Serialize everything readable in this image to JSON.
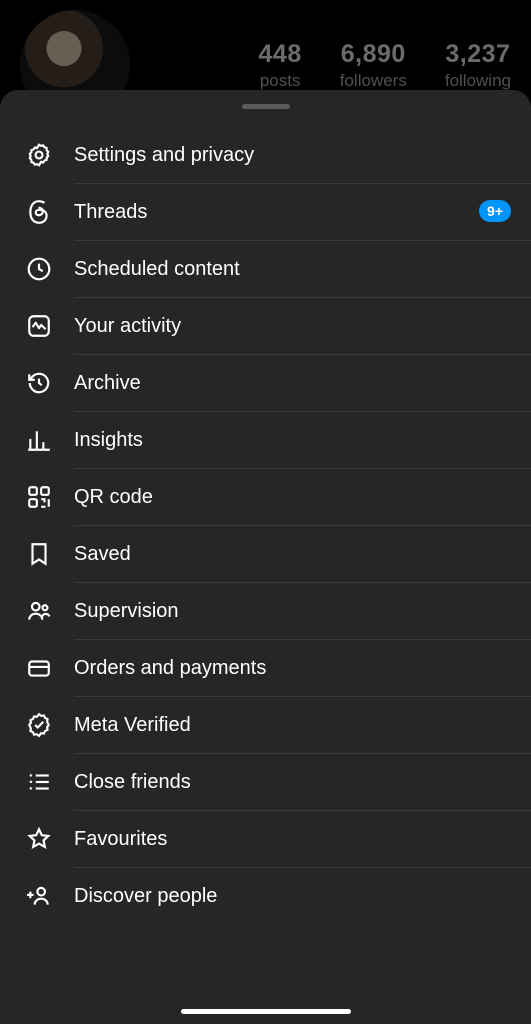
{
  "profile": {
    "stats": {
      "posts": {
        "count": "448",
        "label": "posts"
      },
      "followers": {
        "count": "6,890",
        "label": "followers"
      },
      "following": {
        "count": "3,237",
        "label": "following"
      }
    }
  },
  "menu": {
    "items": [
      {
        "id": "settings",
        "label": "Settings and privacy",
        "badge": null
      },
      {
        "id": "threads",
        "label": "Threads",
        "badge": "9+"
      },
      {
        "id": "scheduled",
        "label": "Scheduled content",
        "badge": null
      },
      {
        "id": "activity",
        "label": "Your activity",
        "badge": null
      },
      {
        "id": "archive",
        "label": "Archive",
        "badge": null
      },
      {
        "id": "insights",
        "label": "Insights",
        "badge": null
      },
      {
        "id": "qrcode",
        "label": "QR code",
        "badge": null
      },
      {
        "id": "saved",
        "label": "Saved",
        "badge": null
      },
      {
        "id": "supervision",
        "label": "Supervision",
        "badge": null
      },
      {
        "id": "orders",
        "label": "Orders and payments",
        "badge": null
      },
      {
        "id": "verified",
        "label": "Meta Verified",
        "badge": null
      },
      {
        "id": "close",
        "label": "Close friends",
        "badge": null
      },
      {
        "id": "favourites",
        "label": "Favourites",
        "badge": null
      },
      {
        "id": "discover",
        "label": "Discover people",
        "badge": null
      }
    ]
  }
}
